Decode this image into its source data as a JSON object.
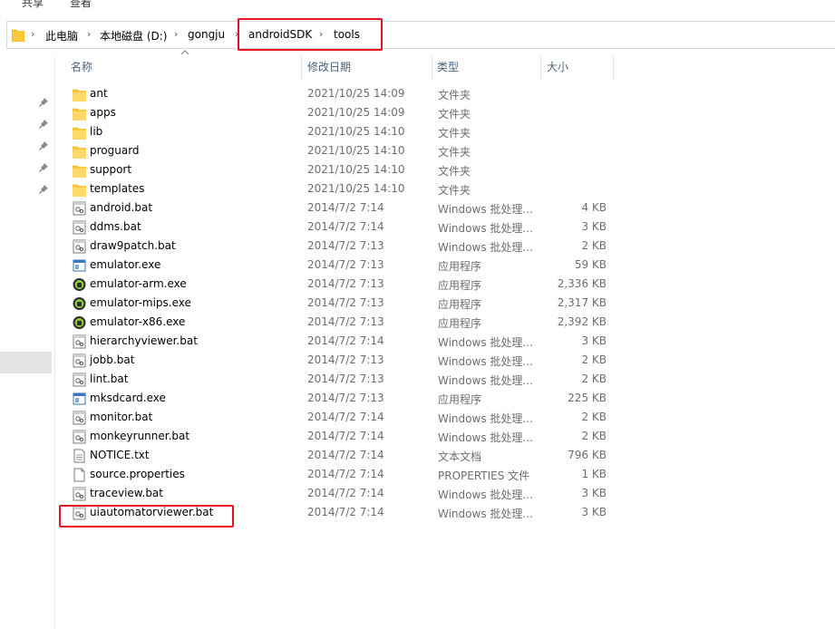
{
  "ribbon": {
    "tabs": [
      "共享",
      "查看"
    ]
  },
  "address": {
    "crumbs": [
      "此电脑",
      "本地磁盘 (D:)",
      "gongju",
      "androidSDK",
      "tools"
    ]
  },
  "columns": {
    "name": "名称",
    "date": "修改日期",
    "type": "类型",
    "size": "大小"
  },
  "files": [
    {
      "name": "ant",
      "date": "2021/10/25 14:09",
      "type": "文件夹",
      "size": "",
      "icon": "folder-icon"
    },
    {
      "name": "apps",
      "date": "2021/10/25 14:09",
      "type": "文件夹",
      "size": "",
      "icon": "folder-icon"
    },
    {
      "name": "lib",
      "date": "2021/10/25 14:10",
      "type": "文件夹",
      "size": "",
      "icon": "folder-icon"
    },
    {
      "name": "proguard",
      "date": "2021/10/25 14:10",
      "type": "文件夹",
      "size": "",
      "icon": "folder-icon"
    },
    {
      "name": "support",
      "date": "2021/10/25 14:10",
      "type": "文件夹",
      "size": "",
      "icon": "folder-icon"
    },
    {
      "name": "templates",
      "date": "2021/10/25 14:10",
      "type": "文件夹",
      "size": "",
      "icon": "folder-icon"
    },
    {
      "name": "android.bat",
      "date": "2014/7/2 7:14",
      "type": "Windows 批处理...",
      "size": "4 KB",
      "icon": "batch-file-icon"
    },
    {
      "name": "ddms.bat",
      "date": "2014/7/2 7:14",
      "type": "Windows 批处理...",
      "size": "3 KB",
      "icon": "batch-file-icon"
    },
    {
      "name": "draw9patch.bat",
      "date": "2014/7/2 7:13",
      "type": "Windows 批处理...",
      "size": "2 KB",
      "icon": "batch-file-icon"
    },
    {
      "name": "emulator.exe",
      "date": "2014/7/2 7:13",
      "type": "应用程序",
      "size": "59 KB",
      "icon": "application-icon"
    },
    {
      "name": "emulator-arm.exe",
      "date": "2014/7/2 7:13",
      "type": "应用程序",
      "size": "2,336 KB",
      "icon": "android-exe-icon"
    },
    {
      "name": "emulator-mips.exe",
      "date": "2014/7/2 7:13",
      "type": "应用程序",
      "size": "2,317 KB",
      "icon": "android-exe-icon"
    },
    {
      "name": "emulator-x86.exe",
      "date": "2014/7/2 7:13",
      "type": "应用程序",
      "size": "2,392 KB",
      "icon": "android-exe-icon"
    },
    {
      "name": "hierarchyviewer.bat",
      "date": "2014/7/2 7:14",
      "type": "Windows 批处理...",
      "size": "3 KB",
      "icon": "batch-file-icon"
    },
    {
      "name": "jobb.bat",
      "date": "2014/7/2 7:13",
      "type": "Windows 批处理...",
      "size": "2 KB",
      "icon": "batch-file-icon"
    },
    {
      "name": "lint.bat",
      "date": "2014/7/2 7:13",
      "type": "Windows 批处理...",
      "size": "2 KB",
      "icon": "batch-file-icon"
    },
    {
      "name": "mksdcard.exe",
      "date": "2014/7/2 7:13",
      "type": "应用程序",
      "size": "225 KB",
      "icon": "application-icon"
    },
    {
      "name": "monitor.bat",
      "date": "2014/7/2 7:14",
      "type": "Windows 批处理...",
      "size": "2 KB",
      "icon": "batch-file-icon"
    },
    {
      "name": "monkeyrunner.bat",
      "date": "2014/7/2 7:14",
      "type": "Windows 批处理...",
      "size": "2 KB",
      "icon": "batch-file-icon"
    },
    {
      "name": "NOTICE.txt",
      "date": "2014/7/2 7:14",
      "type": "文本文档",
      "size": "796 KB",
      "icon": "text-file-icon"
    },
    {
      "name": "source.properties",
      "date": "2014/7/2 7:14",
      "type": "PROPERTIES 文件",
      "size": "1 KB",
      "icon": "blank-file-icon"
    },
    {
      "name": "traceview.bat",
      "date": "2014/7/2 7:14",
      "type": "Windows 批处理...",
      "size": "3 KB",
      "icon": "batch-file-icon"
    },
    {
      "name": "uiautomatorviewer.bat",
      "date": "2014/7/2 7:14",
      "type": "Windows 批处理...",
      "size": "3 KB",
      "icon": "batch-file-icon"
    }
  ],
  "colors": {
    "annotation": "#e81123",
    "folder": "#ffc83d",
    "header_text": "#4c607a"
  }
}
